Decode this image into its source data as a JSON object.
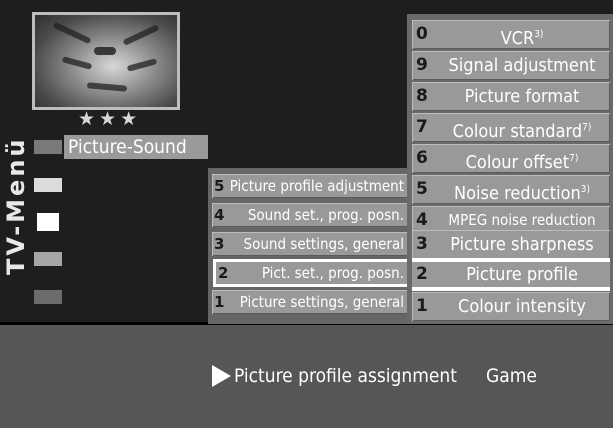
{
  "menu": {
    "vertical_title": "TV-Menü",
    "stars": "★★★",
    "section_label": "Picture-Sound",
    "side_icons": [
      "menu-icon-1",
      "menu-icon-2",
      "menu-icon-3",
      "menu-icon-4",
      "menu-icon-5"
    ]
  },
  "middle": {
    "items": [
      {
        "num": "5",
        "label": "Picture profile adjustment"
      },
      {
        "num": "4",
        "label": "Sound set., prog. posn."
      },
      {
        "num": "3",
        "label": "Sound settings, general"
      },
      {
        "num": "2",
        "label": "Pict. set., prog. posn."
      },
      {
        "num": "1",
        "label": "Picture settings, general"
      }
    ],
    "selected_index": 3
  },
  "right": {
    "items": [
      {
        "num": "0",
        "label": "VCR",
        "sup": "3)"
      },
      {
        "num": "9",
        "label": "Signal adjustment",
        "sup": ""
      },
      {
        "num": "8",
        "label": "Picture format",
        "sup": ""
      },
      {
        "num": "7",
        "label": "Colour standard",
        "sup": "7)"
      },
      {
        "num": "6",
        "label": "Colour offset",
        "sup": "7)"
      },
      {
        "num": "5",
        "label": "Noise reduction",
        "sup": "3)"
      },
      {
        "num": "4",
        "label": "MPEG noise reduction",
        "sup": ""
      },
      {
        "num": "3",
        "label": "Picture sharpness",
        "sup": ""
      },
      {
        "num": "2",
        "label": "Picture profile",
        "sup": ""
      },
      {
        "num": "1",
        "label": "Colour intensity",
        "sup": ""
      }
    ],
    "selected_index": 8
  },
  "bottom": {
    "label": "Picture profile assignment",
    "value": "Game"
  }
}
